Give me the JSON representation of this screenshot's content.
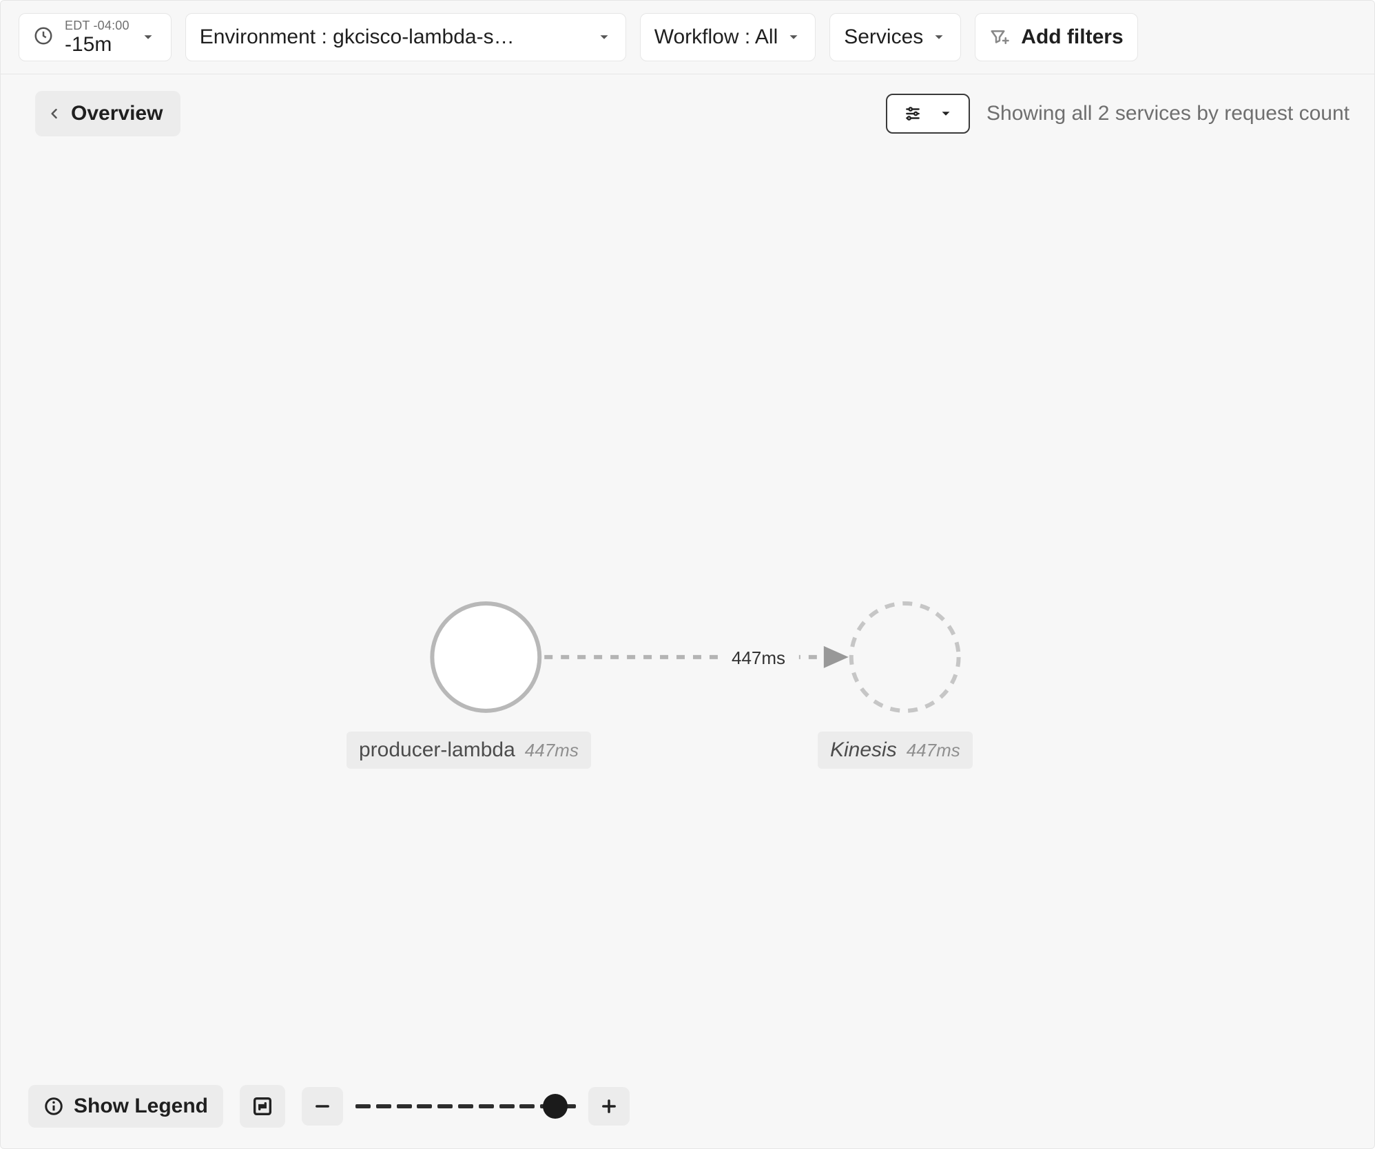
{
  "filters": {
    "timerange": {
      "timezone": "EDT -04:00",
      "value": "-15m"
    },
    "environment": {
      "label": "Environment",
      "separator": " : ",
      "value": "gkcisco-lambda-s…"
    },
    "workflow": {
      "label": "Workflow",
      "separator": " : ",
      "value": "All"
    },
    "services": {
      "label": "Services"
    },
    "addFilters": {
      "label": "Add filters"
    }
  },
  "header": {
    "overview": "Overview",
    "statusText": "Showing all 2 services by request count"
  },
  "map": {
    "edgeLatency": "447ms",
    "nodes": {
      "producer": {
        "name": "producer-lambda",
        "latency": "447ms",
        "style": "solid"
      },
      "kinesis": {
        "name": "Kinesis",
        "latency": "447ms",
        "style": "dashed",
        "italic": true
      }
    }
  },
  "bottom": {
    "legend": "Show Legend",
    "zoom": {
      "minusAria": "Zoom out",
      "plusAria": "Zoom in",
      "fitAria": "Fit to screen"
    }
  }
}
